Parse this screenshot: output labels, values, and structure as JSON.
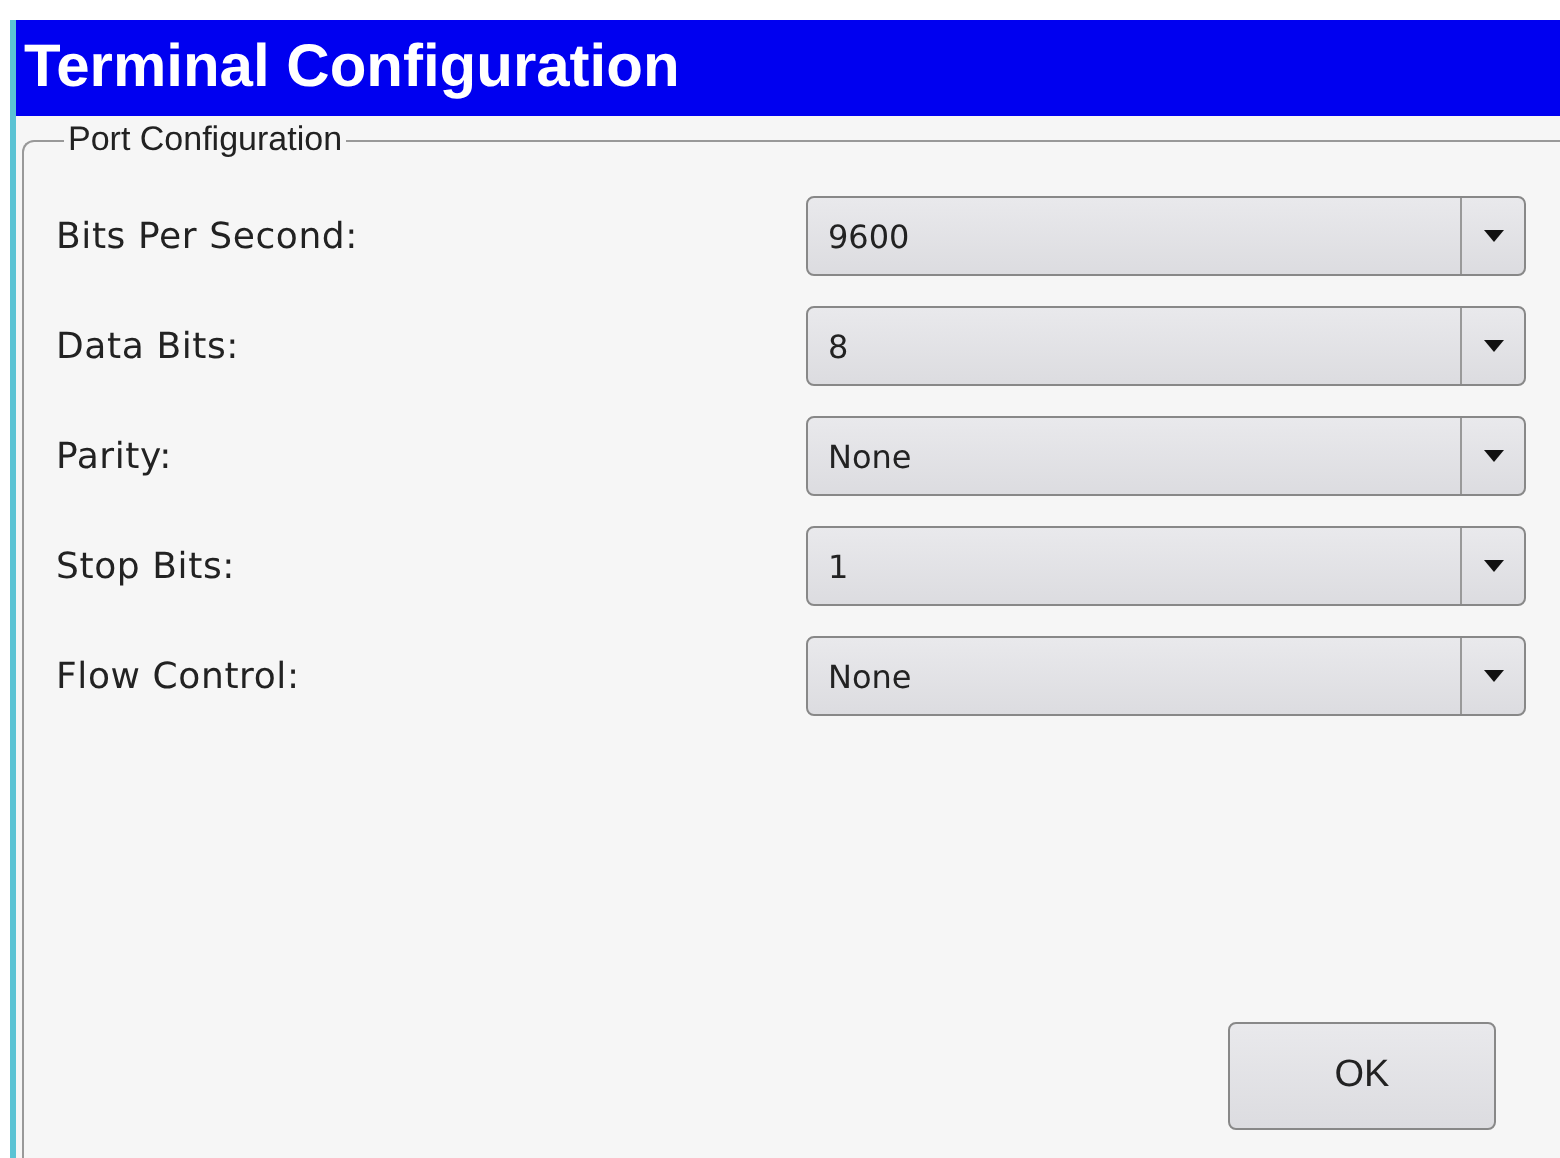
{
  "window": {
    "title": "Terminal Configuration"
  },
  "group": {
    "title": "Port Configuration",
    "fields": [
      {
        "label": "Bits Per Second:",
        "value": "9600"
      },
      {
        "label": "Data Bits:",
        "value": "8"
      },
      {
        "label": "Parity:",
        "value": "None"
      },
      {
        "label": "Stop Bits:",
        "value": "1"
      },
      {
        "label": "Flow Control:",
        "value": "None"
      }
    ]
  },
  "buttons": [
    "OK"
  ]
}
